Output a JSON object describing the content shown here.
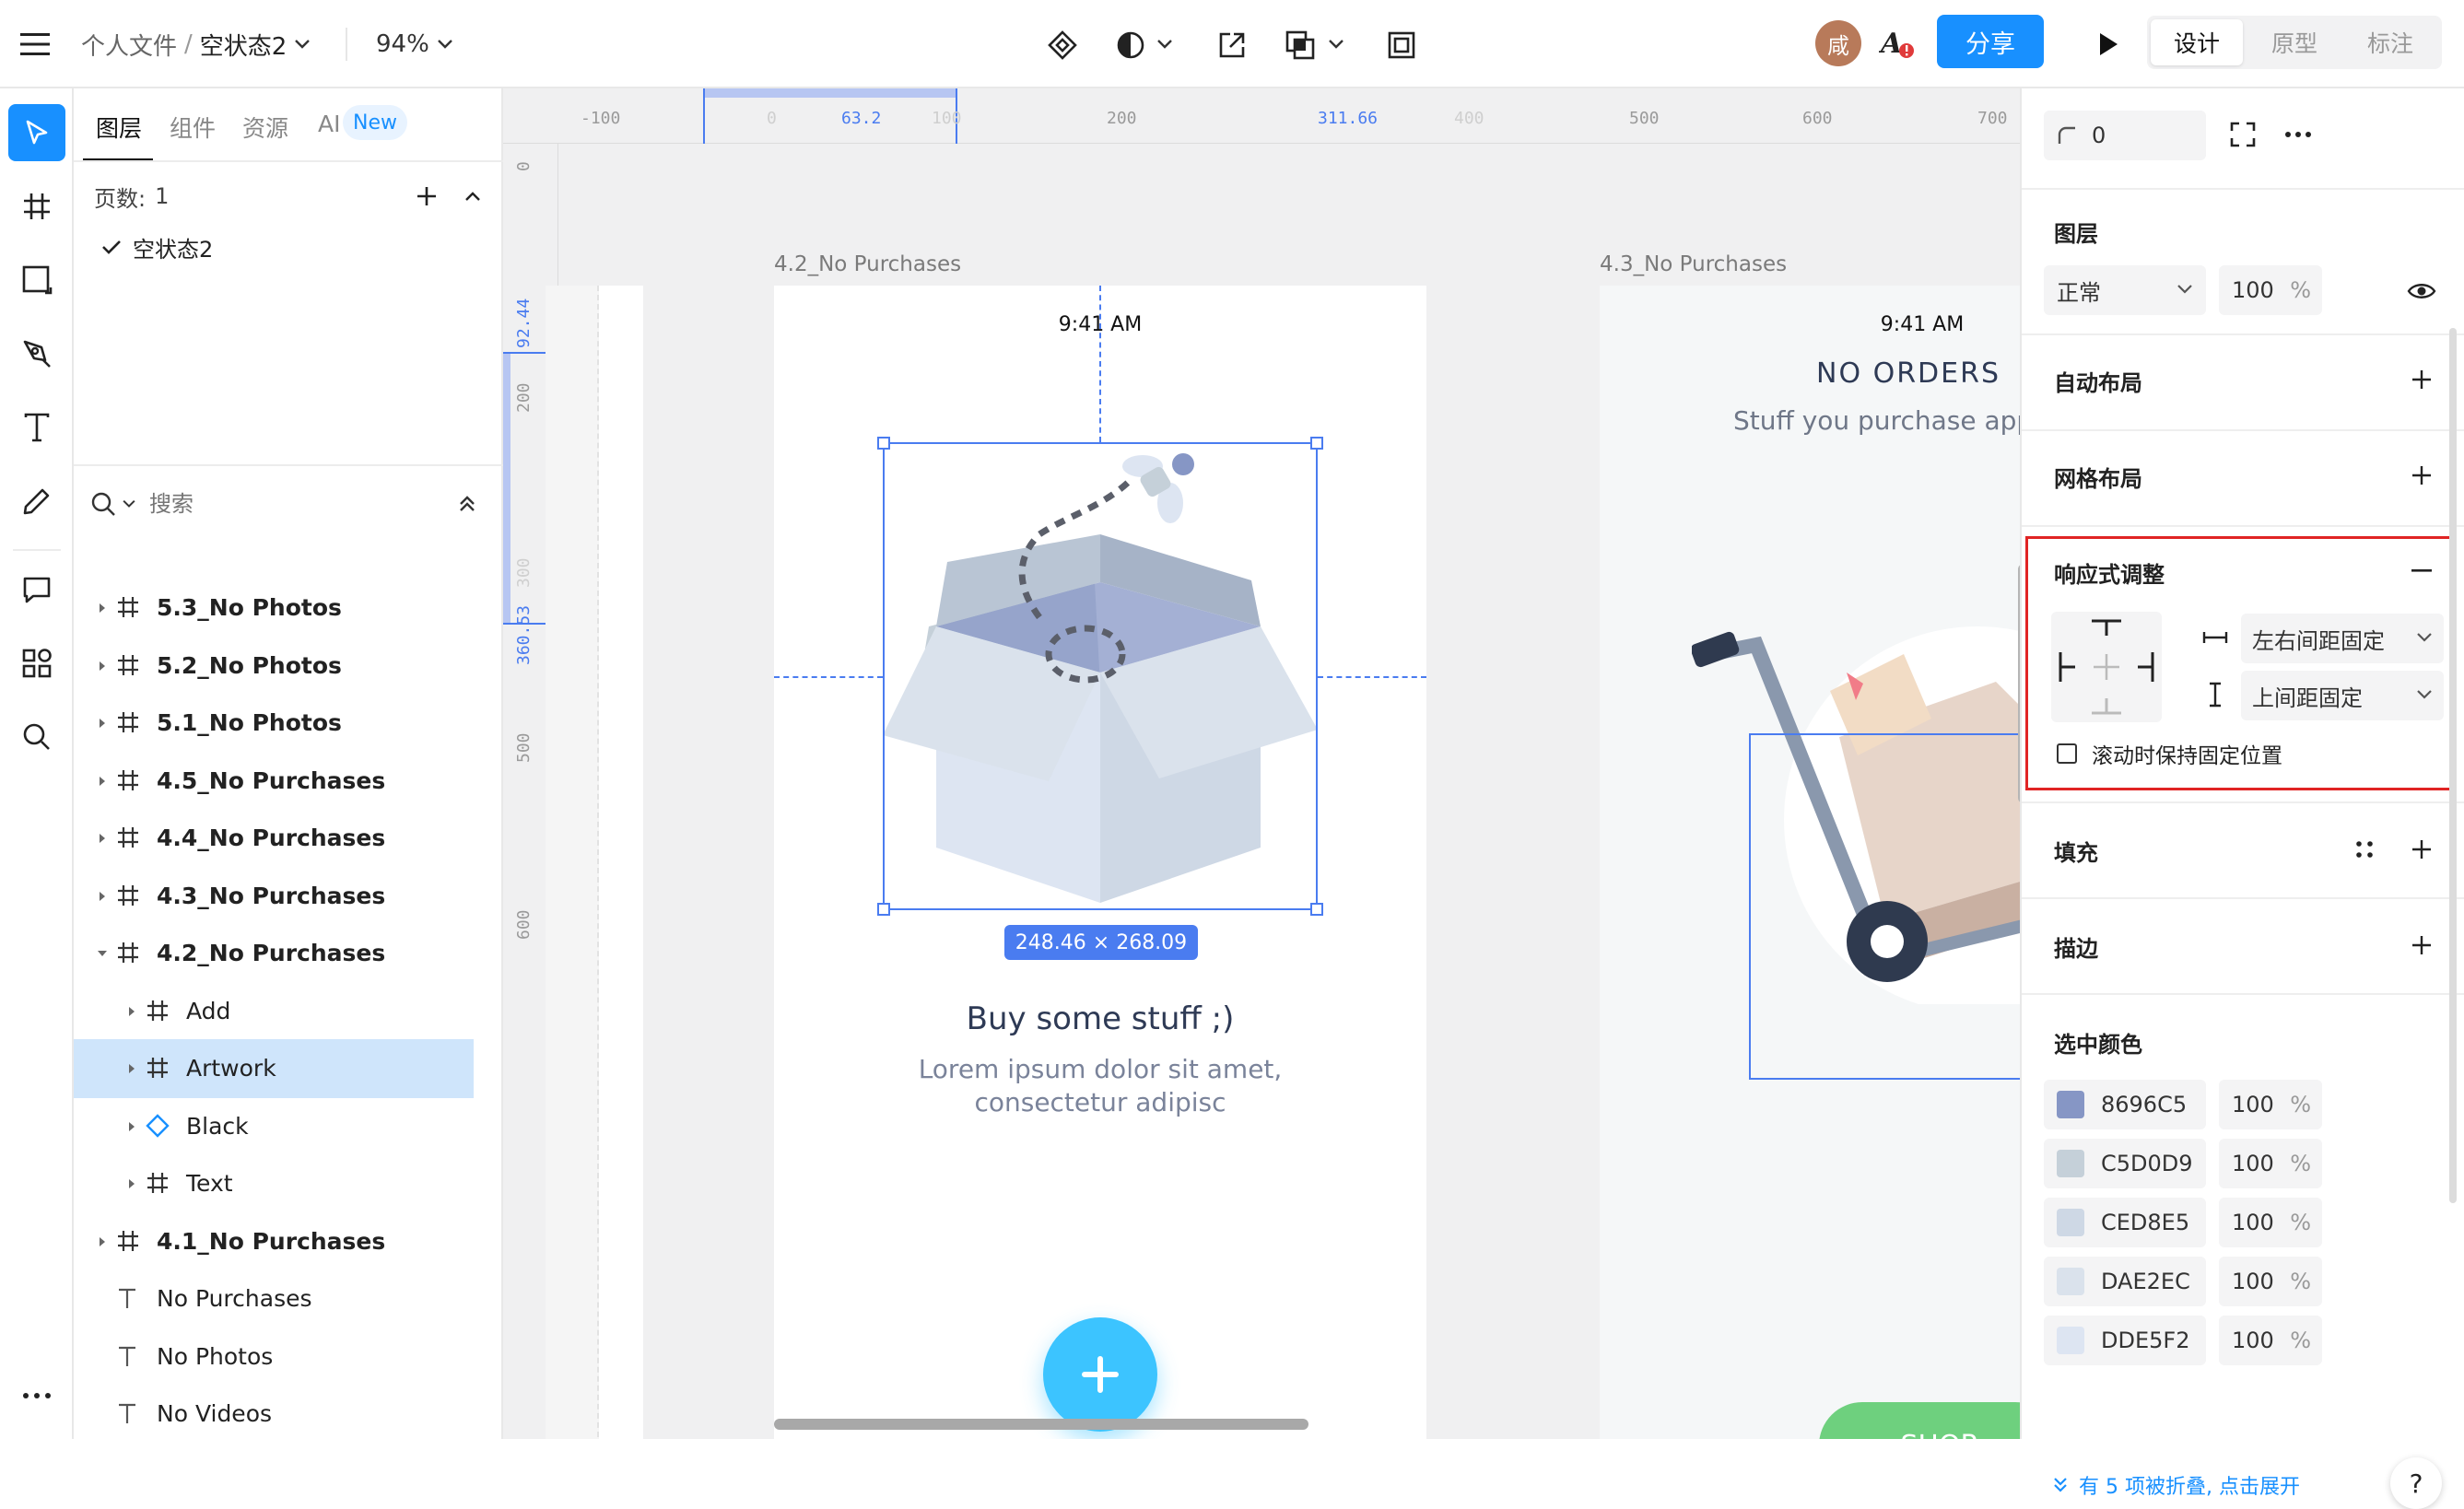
{
  "topbar": {
    "breadcrumb_root": "个人文件",
    "breadcrumb_sep": "/",
    "file_name": "空状态2",
    "zoom": "94%",
    "avatar_initial": "咸",
    "share_label": "分享",
    "mode_tabs": [
      "设计",
      "原型",
      "标注"
    ],
    "active_mode": "设计"
  },
  "layers_panel": {
    "tabs": [
      "图层",
      "组件",
      "资源",
      "AI"
    ],
    "ai_badge": "New",
    "pages_label": "页数:",
    "pages_count": "1",
    "current_page": "空状态2",
    "search_placeholder": "搜索",
    "tree": [
      {
        "label": "5.3_No Photos",
        "type": "frame",
        "level": 0,
        "expanded": false,
        "bold": true
      },
      {
        "label": "5.2_No Photos",
        "type": "frame",
        "level": 0,
        "expanded": false,
        "bold": true
      },
      {
        "label": "5.1_No Photos",
        "type": "frame",
        "level": 0,
        "expanded": false,
        "bold": true
      },
      {
        "label": "4.5_No Purchases",
        "type": "frame",
        "level": 0,
        "expanded": false,
        "bold": true
      },
      {
        "label": "4.4_No Purchases",
        "type": "frame",
        "level": 0,
        "expanded": false,
        "bold": true
      },
      {
        "label": "4.3_No Purchases",
        "type": "frame",
        "level": 0,
        "expanded": false,
        "bold": true
      },
      {
        "label": "4.2_No Purchases",
        "type": "frame",
        "level": 0,
        "expanded": true,
        "bold": true
      },
      {
        "label": "Add",
        "type": "frame",
        "level": 1,
        "expanded": false,
        "bold": false
      },
      {
        "label": "Artwork",
        "type": "frame",
        "level": 1,
        "expanded": false,
        "bold": false,
        "selected": true
      },
      {
        "label": "Black",
        "type": "component",
        "level": 1,
        "expanded": false,
        "bold": false
      },
      {
        "label": "Text",
        "type": "frame",
        "level": 1,
        "expanded": false,
        "bold": false
      },
      {
        "label": "4.1_No Purchases",
        "type": "frame",
        "level": 0,
        "expanded": false,
        "bold": true
      },
      {
        "label": "No Purchases",
        "type": "text",
        "level": 0,
        "bold": false
      },
      {
        "label": "No Photos",
        "type": "text",
        "level": 0,
        "bold": false
      },
      {
        "label": "No Videos",
        "type": "text",
        "level": 0,
        "bold": false
      }
    ]
  },
  "canvas": {
    "ruler_top_labels": [
      "-100",
      "0",
      "63.2",
      "100",
      "200",
      "311.66",
      "400",
      "500",
      "600",
      "700"
    ],
    "ruler_left_labels": [
      "0",
      "92.44",
      "200",
      "300",
      "360.53",
      "500",
      "600"
    ],
    "frame_a_name": "4.2_No Purchases",
    "frame_b_name": "4.3_No Purchases",
    "frame_a": {
      "time": "9:41 AM",
      "selection_size": "248.46 × 268.09",
      "title": "Buy some stuff ;)",
      "body_line1": "Lorem ipsum dolor sit amet,",
      "body_line2": "consectetur adipisc"
    },
    "frame_b": {
      "time": "9:41 AM",
      "title": "NO ORDERS",
      "subtitle": "Stuff you purchase app",
      "shop_label": "SHOP"
    }
  },
  "props_panel": {
    "corner_radius": "0",
    "layer_title": "图层",
    "blend_mode": "正常",
    "opacity": "100",
    "percent": "%",
    "auto_layout_title": "自动布局",
    "grid_layout_title": "网格布局",
    "responsive_title": "响应式调整",
    "horizontal_constraint": "左右间距固定",
    "vertical_constraint": "上间距固定",
    "fixed_scroll_label": "滚动时保持固定位置",
    "fill_title": "填充",
    "stroke_title": "描边",
    "selected_colors_title": "选中颜色",
    "colors": [
      {
        "hex": "8696C5",
        "swatch": "#8696C5",
        "opacity": "100"
      },
      {
        "hex": "C5D0D9",
        "swatch": "#C5D0D9",
        "opacity": "100"
      },
      {
        "hex": "CED8E5",
        "swatch": "#CED8E5",
        "opacity": "100"
      },
      {
        "hex": "DAE2EC",
        "swatch": "#DAE2EC",
        "opacity": "100"
      },
      {
        "hex": "DDE5F2",
        "swatch": "#DDE5F2",
        "opacity": "100"
      }
    ],
    "collapsed_note": "有 5 项被折叠, 点击展开",
    "help": "?"
  },
  "theme": {
    "accent": "#1890FF",
    "selection": "#4A7CF0",
    "highlight_red": "#E02424",
    "fab": "#3CC4FF",
    "shop_green": "#6ED07E"
  }
}
